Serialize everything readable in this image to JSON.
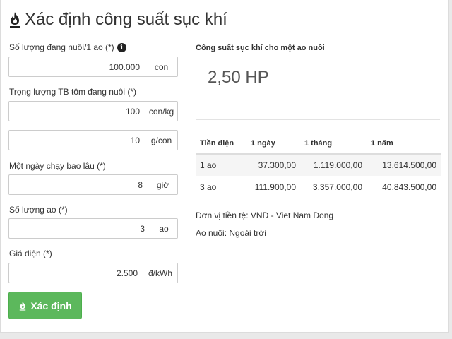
{
  "page": {
    "title": "Xác định công suất sục khí"
  },
  "form": {
    "fields": [
      {
        "label": "Số lượng đang nuôi/1 ao (*)",
        "value": "100.000",
        "unit": "con"
      },
      {
        "label": "Trọng lượng TB tôm đang nuôi (*)",
        "value": "100",
        "unit": "con/kg"
      },
      {
        "label": "",
        "value": "10",
        "unit": "g/con"
      },
      {
        "label": "Một ngày chạy bao lâu (*)",
        "value": "8",
        "unit": "giờ"
      },
      {
        "label": "Số lượng ao (*)",
        "value": "3",
        "unit": "ao"
      },
      {
        "label": "Giá điện (*)",
        "value": "2.500",
        "unit": "đ/kWh"
      }
    ],
    "submit_label": "Xác định"
  },
  "result": {
    "heading": "Công suất sục khí cho một ao nuôi",
    "value": "2,50 HP",
    "table": {
      "headers": [
        "Tiền điện",
        "1 ngày",
        "1 tháng",
        "1 năm"
      ],
      "rows": [
        [
          "1 ao",
          "37.300,00",
          "1.119.000,00",
          "13.614.500,00"
        ],
        [
          "3 ao",
          "111.900,00",
          "3.357.000,00",
          "40.843.500,00"
        ]
      ]
    },
    "currency_note": "Đơn vị tiền tệ: VND - Viet Nam Dong",
    "pond_note": "Ao nuôi: Ngoài trời"
  },
  "colors": {
    "button": "#5cb85c",
    "stripe": "#f5f5f5"
  }
}
